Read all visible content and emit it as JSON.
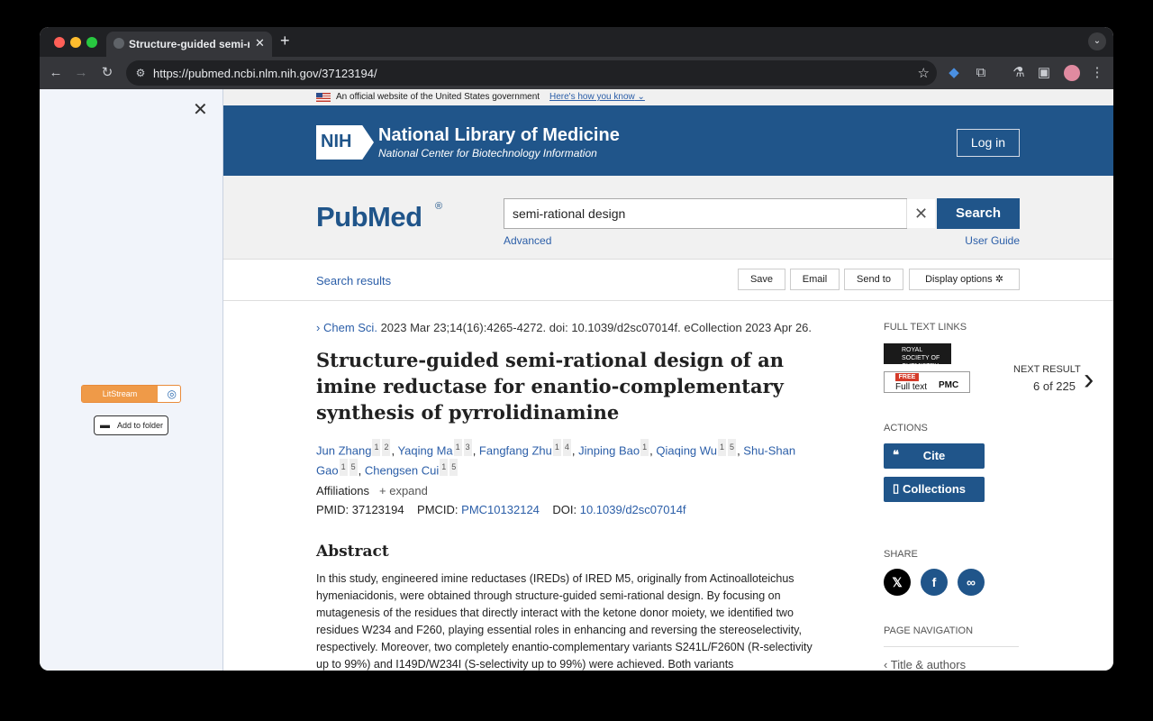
{
  "browser": {
    "tab_title": "Structure-guided semi-rational design",
    "tab_close": "✕",
    "new_tab": "+",
    "url": "https://pubmed.ncbi.nlm.nih.gov/37123194/",
    "icons": [
      "back-icon",
      "forward-icon",
      "reload-icon",
      "site-info-icon",
      "star-icon",
      "extension-icon",
      "puzzle-icon",
      "labs-icon",
      "sidepanel-icon",
      "profile-icon",
      "menu-icon"
    ]
  },
  "sidebar": {
    "litstream_label": "LitStream",
    "add_folder_label": "Add to folder"
  },
  "gov_banner": {
    "text": "An official website of the United States government",
    "link": "Here's how you know"
  },
  "nlm": {
    "nih_logo": "NIH",
    "title": "National Library of Medicine",
    "subtitle": "National Center for Biotechnology Information",
    "login": "Log in"
  },
  "search": {
    "logo": "PubMed",
    "logo_reg": "®",
    "query": "semi-rational design",
    "button": "Search",
    "advanced": "Advanced",
    "user_guide": "User Guide"
  },
  "actions_bar": {
    "search_results": "Search results",
    "save": "Save",
    "email": "Email",
    "send_to": "Send to",
    "display_options": "Display options"
  },
  "article": {
    "journal": "Chem Sci.",
    "citation": "2023 Mar 23;14(16):4265-4272. doi: 10.1039/d2sc07014f. eCollection 2023 Apr 26.",
    "title": "Structure-guided semi-rational design of an imine reductase for enantio-complementary synthesis of pyrrolidinamine",
    "authors": [
      {
        "name": "Jun Zhang",
        "affs": [
          "1",
          "2"
        ]
      },
      {
        "name": "Yaqing Ma",
        "affs": [
          "1",
          "3"
        ]
      },
      {
        "name": "Fangfang Zhu",
        "affs": [
          "1",
          "4"
        ]
      },
      {
        "name": "Jinping Bao",
        "affs": [
          "1"
        ]
      },
      {
        "name": "Qiaqing Wu",
        "affs": [
          "1",
          "5"
        ]
      },
      {
        "name": "Shu-Shan Gao",
        "affs": [
          "1",
          "5"
        ]
      },
      {
        "name": "Chengsen Cui",
        "affs": [
          "1",
          "5"
        ]
      }
    ],
    "affiliations_label": "Affiliations",
    "expand_label": "expand",
    "pmid_label": "PMID:",
    "pmid": "37123194",
    "pmcid_label": "PMCID:",
    "pmcid": "PMC10132124",
    "doi_label": "DOI:",
    "doi": "10.1039/d2sc07014f",
    "abstract_heading": "Abstract",
    "abstract": "In this study, engineered imine reductases (IREDs) of IRED M5, originally from Actinoalloteichus hymeniacidonis, were obtained through structure-guided semi-rational design. By focusing on mutagenesis of the residues that directly interact with the ketone donor moiety, we identified two residues W234 and F260, playing essential roles in enhancing and reversing the stereoselectivity, respectively. Moreover, two completely enantio-complementary variants S241L/F260N (R-selectivity up to 99%) and I149D/W234I (S-selectivity up to 99%) were achieved. Both variants"
  },
  "right_panel": {
    "full_text_links": "FULL TEXT LINKS",
    "rsc_text": "ROYAL SOCIETY OF CHEMISTRY",
    "pmc_free": "FREE",
    "pmc_full": "Full text",
    "pmc_label": "PMC",
    "actions": "ACTIONS",
    "cite": "Cite",
    "collections": "Collections",
    "share": "SHARE",
    "page_navigation": "PAGE NAVIGATION",
    "nav_item": "Title & authors",
    "next_result": "NEXT RESULT",
    "next_count": "6 of 225"
  },
  "colors": {
    "nlm_blue": "#20558a",
    "link": "#2b5ea8",
    "litstream": "#ef9a48"
  }
}
